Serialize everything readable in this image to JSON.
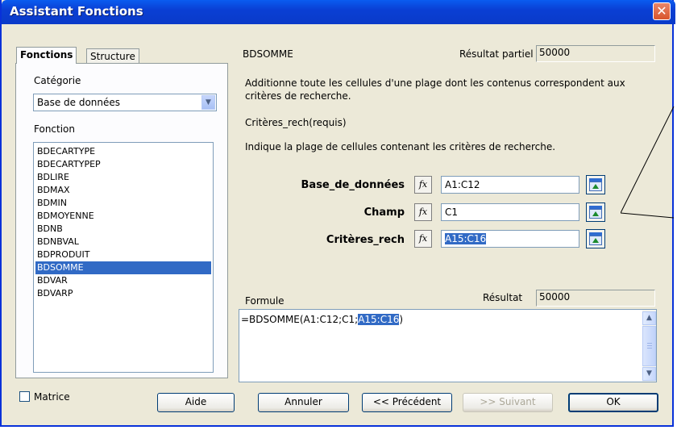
{
  "window": {
    "title": "Assistant Fonctions",
    "close_glyph": "✕"
  },
  "tabs": [
    {
      "label": "Fonctions"
    },
    {
      "label": "Structure"
    }
  ],
  "category": {
    "label": "Catégorie",
    "value": "Base de données"
  },
  "function_list": {
    "label": "Fonction",
    "items": [
      "BDECARTYPE",
      "BDECARTYPEP",
      "BDLIRE",
      "BDMAX",
      "BDMIN",
      "BDMOYENNE",
      "BDNB",
      "BDNBVAL",
      "BDPRODUIT",
      "BDSOMME",
      "BDVAR",
      "BDVARP"
    ],
    "selected": "BDSOMME"
  },
  "function_info": {
    "name": "BDSOMME",
    "partial_result_label": "Résultat partiel",
    "partial_result_value": "50000",
    "description": "Additionne toute les cellules d'une plage dont les contenus correspondent aux critères de recherche.",
    "arg_title": "Critères_rech(requis)",
    "arg_description": "Indique la plage de cellules contenant les critères de recherche."
  },
  "arguments": [
    {
      "label": "Base_de_données",
      "value": "A1:C12"
    },
    {
      "label": "Champ",
      "value": "C1"
    },
    {
      "label": "Critères_rech",
      "value": "A15:C16"
    }
  ],
  "fx_glyph": "fx",
  "formula": {
    "label": "Formule",
    "result_label": "Résultat",
    "result_value": "50000",
    "text_prefix": "=BDSOMME(A1:C12;C1;",
    "text_highlight": "A15:C16",
    "text_suffix": ")"
  },
  "matrix": {
    "label": "Matrice",
    "checked": false
  },
  "buttons": {
    "help": "Aide",
    "cancel": "Annuler",
    "previous": "<< Précédent",
    "next": ">> Suivant",
    "ok": "OK"
  },
  "scroll": {
    "up_glyph": "▲",
    "down_glyph": "▼"
  },
  "combo_arrow_glyph": "▼"
}
